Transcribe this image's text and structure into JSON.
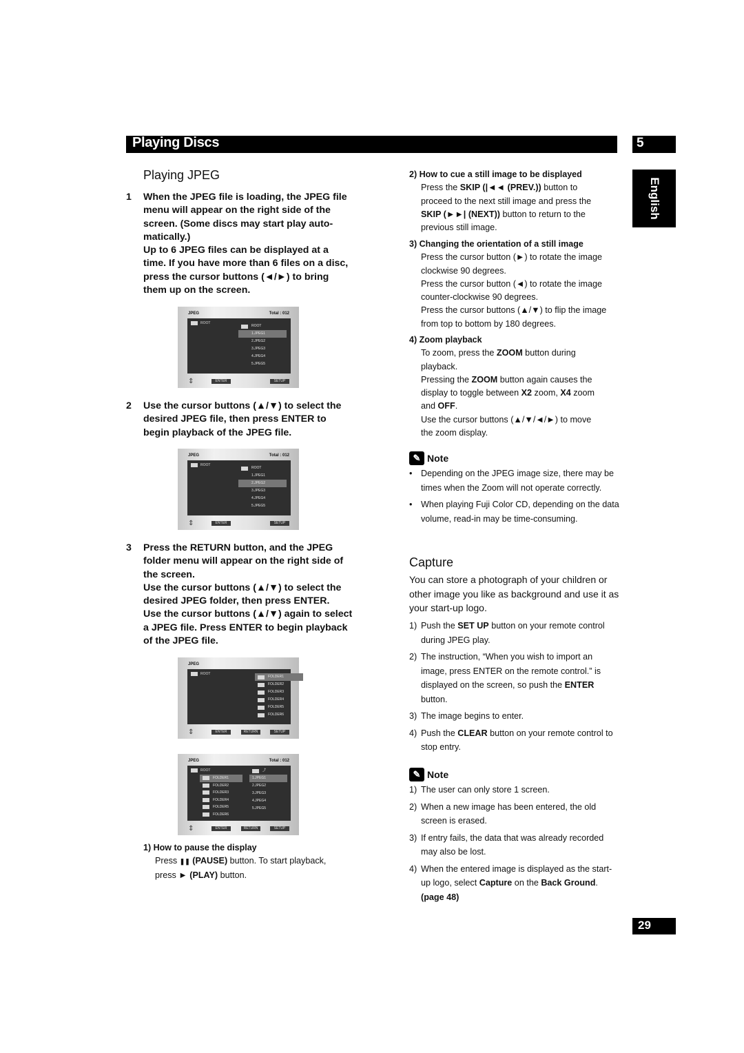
{
  "header": {
    "title": "Playing Discs",
    "chapter": "5",
    "language_tab": "English",
    "page_number": "29"
  },
  "playing_jpeg": {
    "heading": "Playing JPEG",
    "steps": [
      {
        "num": "1",
        "text": "When the JPEG file is loading, the JPEG file menu will appear on the right side of the screen. (Some discs may start play auto-matically.)",
        "text2": "Up to 6 JPEG files can be displayed at a time. If you have more than 6 files on a disc, press the cursor buttons (◄/►) to bring them up on the screen."
      },
      {
        "num": "2",
        "text": "Use the cursor buttons (▲/▼) to select the desired JPEG file, then press ENTER to begin playback of the JPEG file."
      },
      {
        "num": "3",
        "text": "Press the RETURN button, and the JPEG folder menu will appear on the right side of the screen.",
        "text2": "Use the cursor buttons (▲/▼) to select the desired JPEG folder, then press ENTER.",
        "text3": "Use the cursor buttons (▲/▼) again to select a JPEG file. Press ENTER to begin playback of the JPEG file."
      }
    ],
    "pause": {
      "heading": "1) How to pause the display",
      "line1_a": "Press ",
      "icon1": "❚❚",
      "line1_b": " (PAUSE)",
      "line1_c": " button. To start playback,",
      "line2_a": "press ",
      "icon2": "►",
      "line2_b": " (PLAY)",
      "line2_c": " button."
    }
  },
  "screens": [
    {
      "title": "JPEG",
      "total": "Total : 012",
      "left_root": "ROOT",
      "items": [
        "ROOT",
        "1.JPEG1",
        "2.JPEG2",
        "3.JPEG3",
        "4.JPEG4",
        "5.JPEG5"
      ],
      "selected": 1,
      "buttons": [
        "ENTER",
        "SETUP"
      ]
    },
    {
      "title": "JPEG",
      "total": "Total : 012",
      "left_root": "ROOT",
      "items": [
        "ROOT",
        "1.JPEG1",
        "2.JPEG2",
        "3.JPEG3",
        "4.JPEG4",
        "5.JPEG5"
      ],
      "selected": 2,
      "buttons": [
        "ENTER",
        "SETUP"
      ]
    },
    {
      "title": "JPEG",
      "total": "",
      "left_root": "ROOT",
      "items": [
        "FOLDER1",
        "FOLDER2",
        "FOLDER3",
        "FOLDER4",
        "FOLDER5",
        "FOLDER6"
      ],
      "selected": 0,
      "buttons": [
        "ENTER",
        "RETURN",
        "SETUP"
      ]
    },
    {
      "title": "JPEG",
      "total": "Total : 012",
      "left_root": "ROOT",
      "left_folders": [
        "FOLDER1",
        "FOLDER2",
        "FOLDER3",
        "FOLDER4",
        "FOLDER5",
        "FOLDER6"
      ],
      "items": [
        "1.JPEG1",
        "2.JPEG2",
        "3.JPEG3",
        "4.JPEG4",
        "5.JPEG5"
      ],
      "selected": 0,
      "buttons": [
        "ENTER",
        "RETURN",
        "SETUP"
      ]
    }
  ],
  "right_col": {
    "cue": {
      "heading": "2) How to cue a still image to be displayed",
      "l1": "Press the ",
      "skip": "SKIP",
      "prev": " (|◄◄ (PREV.))",
      "l1b": " button to",
      "l2": "proceed to the next still image and press the",
      "next": " (►►| (NEXT))",
      "l3b": " button to return to the",
      "l4": "previous still image."
    },
    "orient": {
      "heading": "3) Changing the orientation of a still image",
      "lines": [
        "Press the cursor button (►) to rotate the image",
        "clockwise 90 degrees.",
        "Press the cursor button (◄) to rotate the image",
        "counter-clockwise 90 degrees.",
        "Press the cursor buttons (▲/▼) to flip the image",
        "from top to bottom by 180 degrees."
      ]
    },
    "zoom": {
      "heading": "4) Zoom playback",
      "l1a": "To zoom, press the ",
      "zoom": "ZOOM",
      "l1b": " button during",
      "l2": "playback.",
      "l3a": "Pressing the ",
      "l3b": " button again causes the",
      "l4a": "display to toggle between ",
      "x2": "X2",
      "l4b": " zoom, ",
      "x4": "X4",
      "l4c": " zoom",
      "l5a": "and ",
      "off": "OFF",
      "l5b": ".",
      "l6": "Use the cursor buttons (▲/▼/◄/►) to move",
      "l7": "the zoom display."
    },
    "note1": {
      "title": "Note",
      "bullets": [
        "Depending on the JPEG image size, there may be times when the Zoom will not operate correctly.",
        "When playing Fuji Color CD, depending on the data volume, read-in may be time-consuming."
      ]
    },
    "capture": {
      "heading": "Capture",
      "intro": "You can store a photograph of your children or other image you like as background and use it as your start-up logo.",
      "steps": [
        {
          "n": "1)",
          "a": "Push the ",
          "b": "SET UP",
          "c": " button on your remote control during JPEG play."
        },
        {
          "n": "2)",
          "a": "The instruction, “When you wish to import an image, press ENTER on the remote control.” is displayed on the screen, so push the ",
          "b": "ENTER",
          "c": " button."
        },
        {
          "n": "3)",
          "a": "The image begins to enter.",
          "b": "",
          "c": ""
        },
        {
          "n": "4)",
          "a": "Push the ",
          "b": "CLEAR",
          "c": " button on your remote control to stop entry."
        }
      ]
    },
    "note2": {
      "title": "Note",
      "items": [
        {
          "n": "1)",
          "a": "The user can only store 1 screen."
        },
        {
          "n": "2)",
          "a": "When a new image has been entered, the old screen is erased."
        },
        {
          "n": "3)",
          "a": "If entry fails, the data that was already recorded may also be lost."
        },
        {
          "n": "4)",
          "a": "When the entered image is displayed as the start-up logo, select ",
          "b": "Capture",
          "c": " on the ",
          "d": "Back Ground",
          "e": ". ",
          "f": "(page 48)"
        }
      ]
    }
  }
}
